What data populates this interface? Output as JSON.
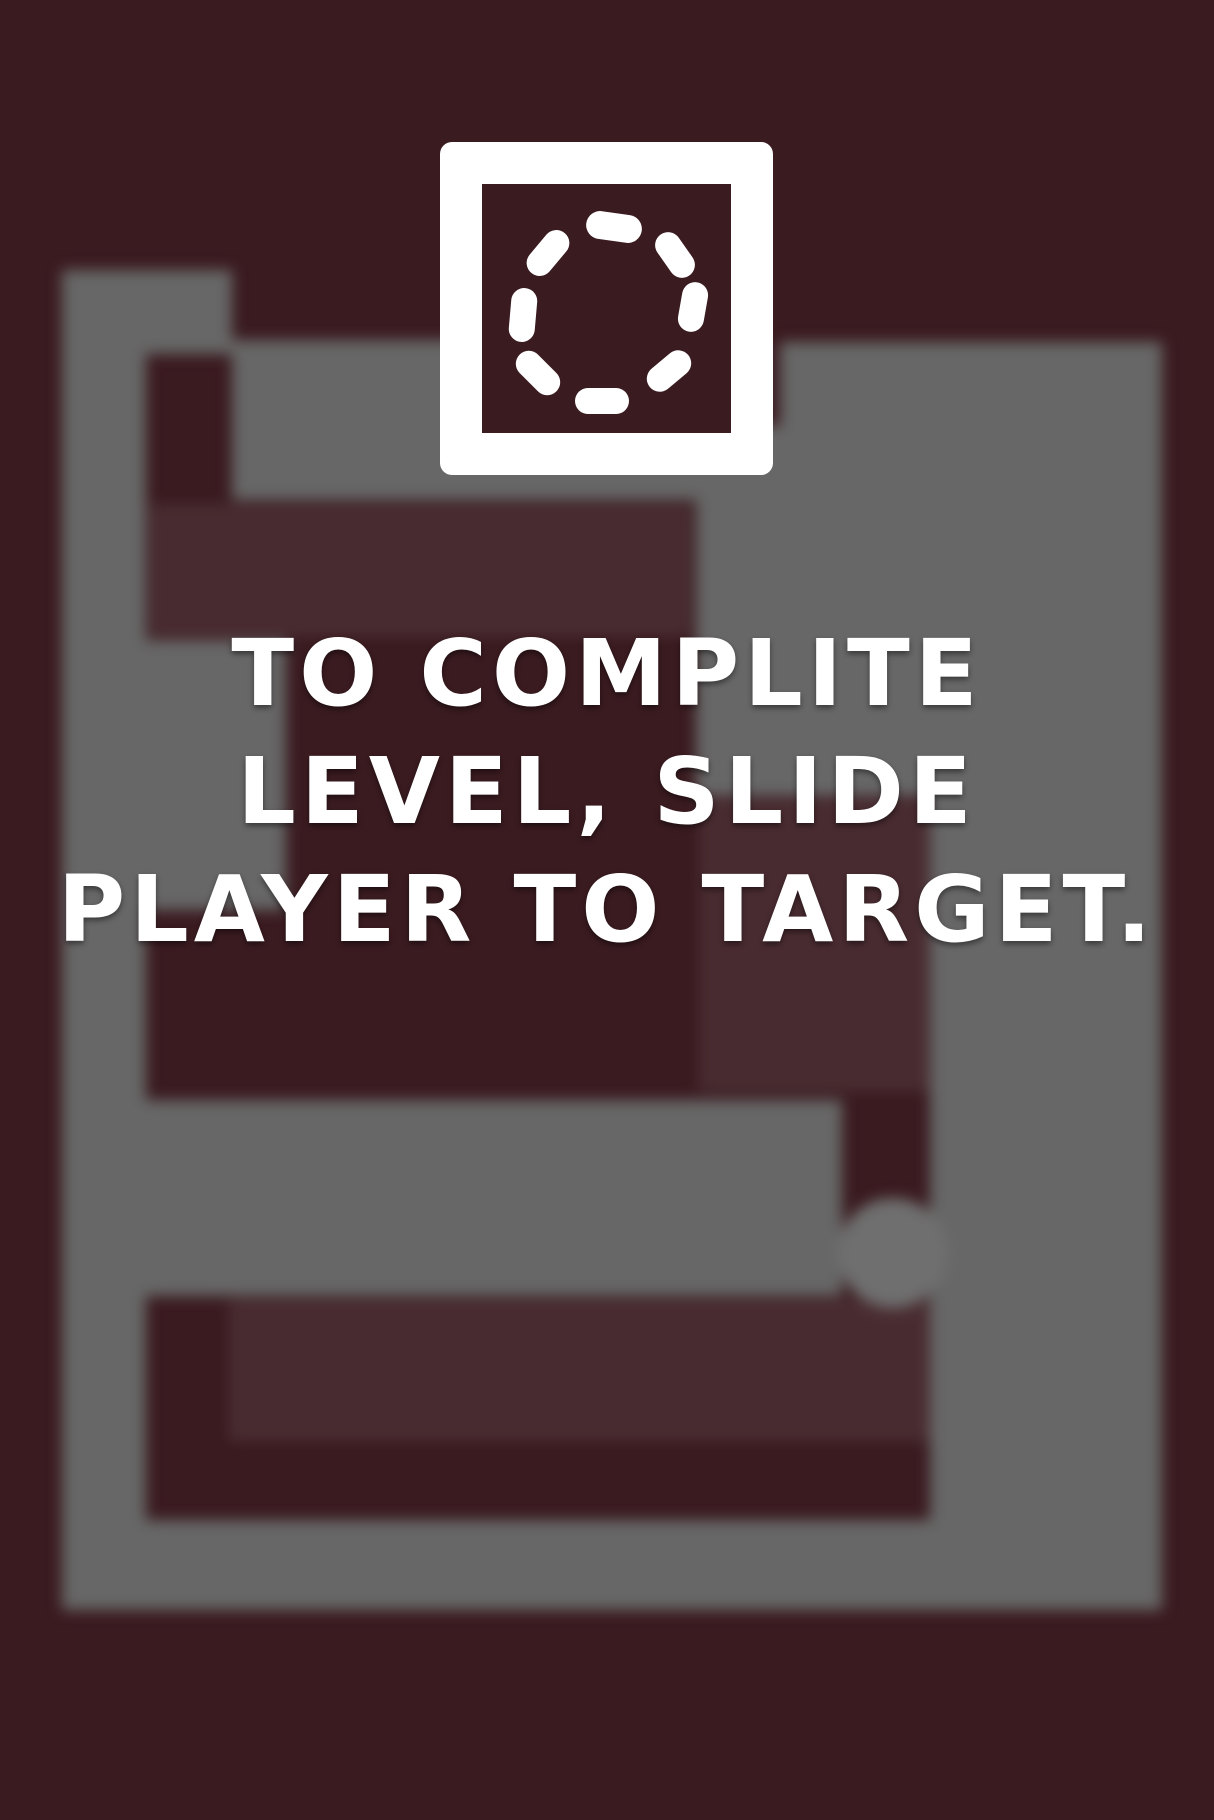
{
  "screen": {
    "background_color": "#3a1b20",
    "wall_color": "#676767",
    "text_color": "#ffffff"
  },
  "goal_icon": {
    "name": "target-ring-icon"
  },
  "instruction": {
    "line1": "TO COMPLITE",
    "line2": "LEVEL, SLIDE",
    "line3": "PLAYER TO TARGET."
  }
}
